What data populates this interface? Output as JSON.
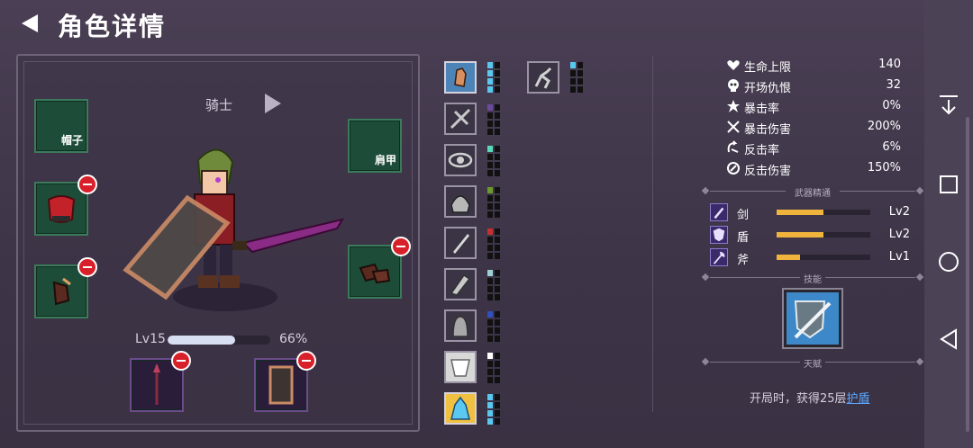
{
  "header": {
    "title": "角色详情"
  },
  "character": {
    "class_name": "骑士",
    "level_label": "Lv15",
    "xp_percent_label": "66%",
    "xp_fraction": 0.66
  },
  "equipment": {
    "hat_label": "帽子",
    "shoulder_label": "肩甲"
  },
  "stats": [
    {
      "icon": "heart-icon",
      "name": "生命上限",
      "value": "140"
    },
    {
      "icon": "skull-icon",
      "name": "开场仇恨",
      "value": "32"
    },
    {
      "icon": "burst-icon",
      "name": "暴击率",
      "value": "0%"
    },
    {
      "icon": "crossed-swords-icon",
      "name": "暴击伤害",
      "value": "200%"
    },
    {
      "icon": "counter-icon",
      "name": "反击率",
      "value": "6%"
    },
    {
      "icon": "counter-damage-icon",
      "name": "反击伤害",
      "value": "150%"
    }
  ],
  "mastery": {
    "title": "武器精通",
    "items": [
      {
        "icon": "sword-icon",
        "name": "剑",
        "fill": 0.5,
        "level": "Lv2"
      },
      {
        "icon": "shield-icon",
        "name": "盾",
        "fill": 0.5,
        "level": "Lv2"
      },
      {
        "icon": "axe-icon",
        "name": "斧",
        "fill": 0.25,
        "level": "Lv1"
      }
    ]
  },
  "skills_title": "技能",
  "talent": {
    "title": "天赋",
    "text_prefix": "开局时，获得25层",
    "link_text": "护盾"
  },
  "colors": {
    "background": "#3d3447",
    "equip_slot": "#1d4c38",
    "weapon_slot": "#2a1d3a",
    "remove_badge": "#d8202a",
    "mastery_bar": "#f0b43c",
    "link": "#5aa8ff"
  }
}
